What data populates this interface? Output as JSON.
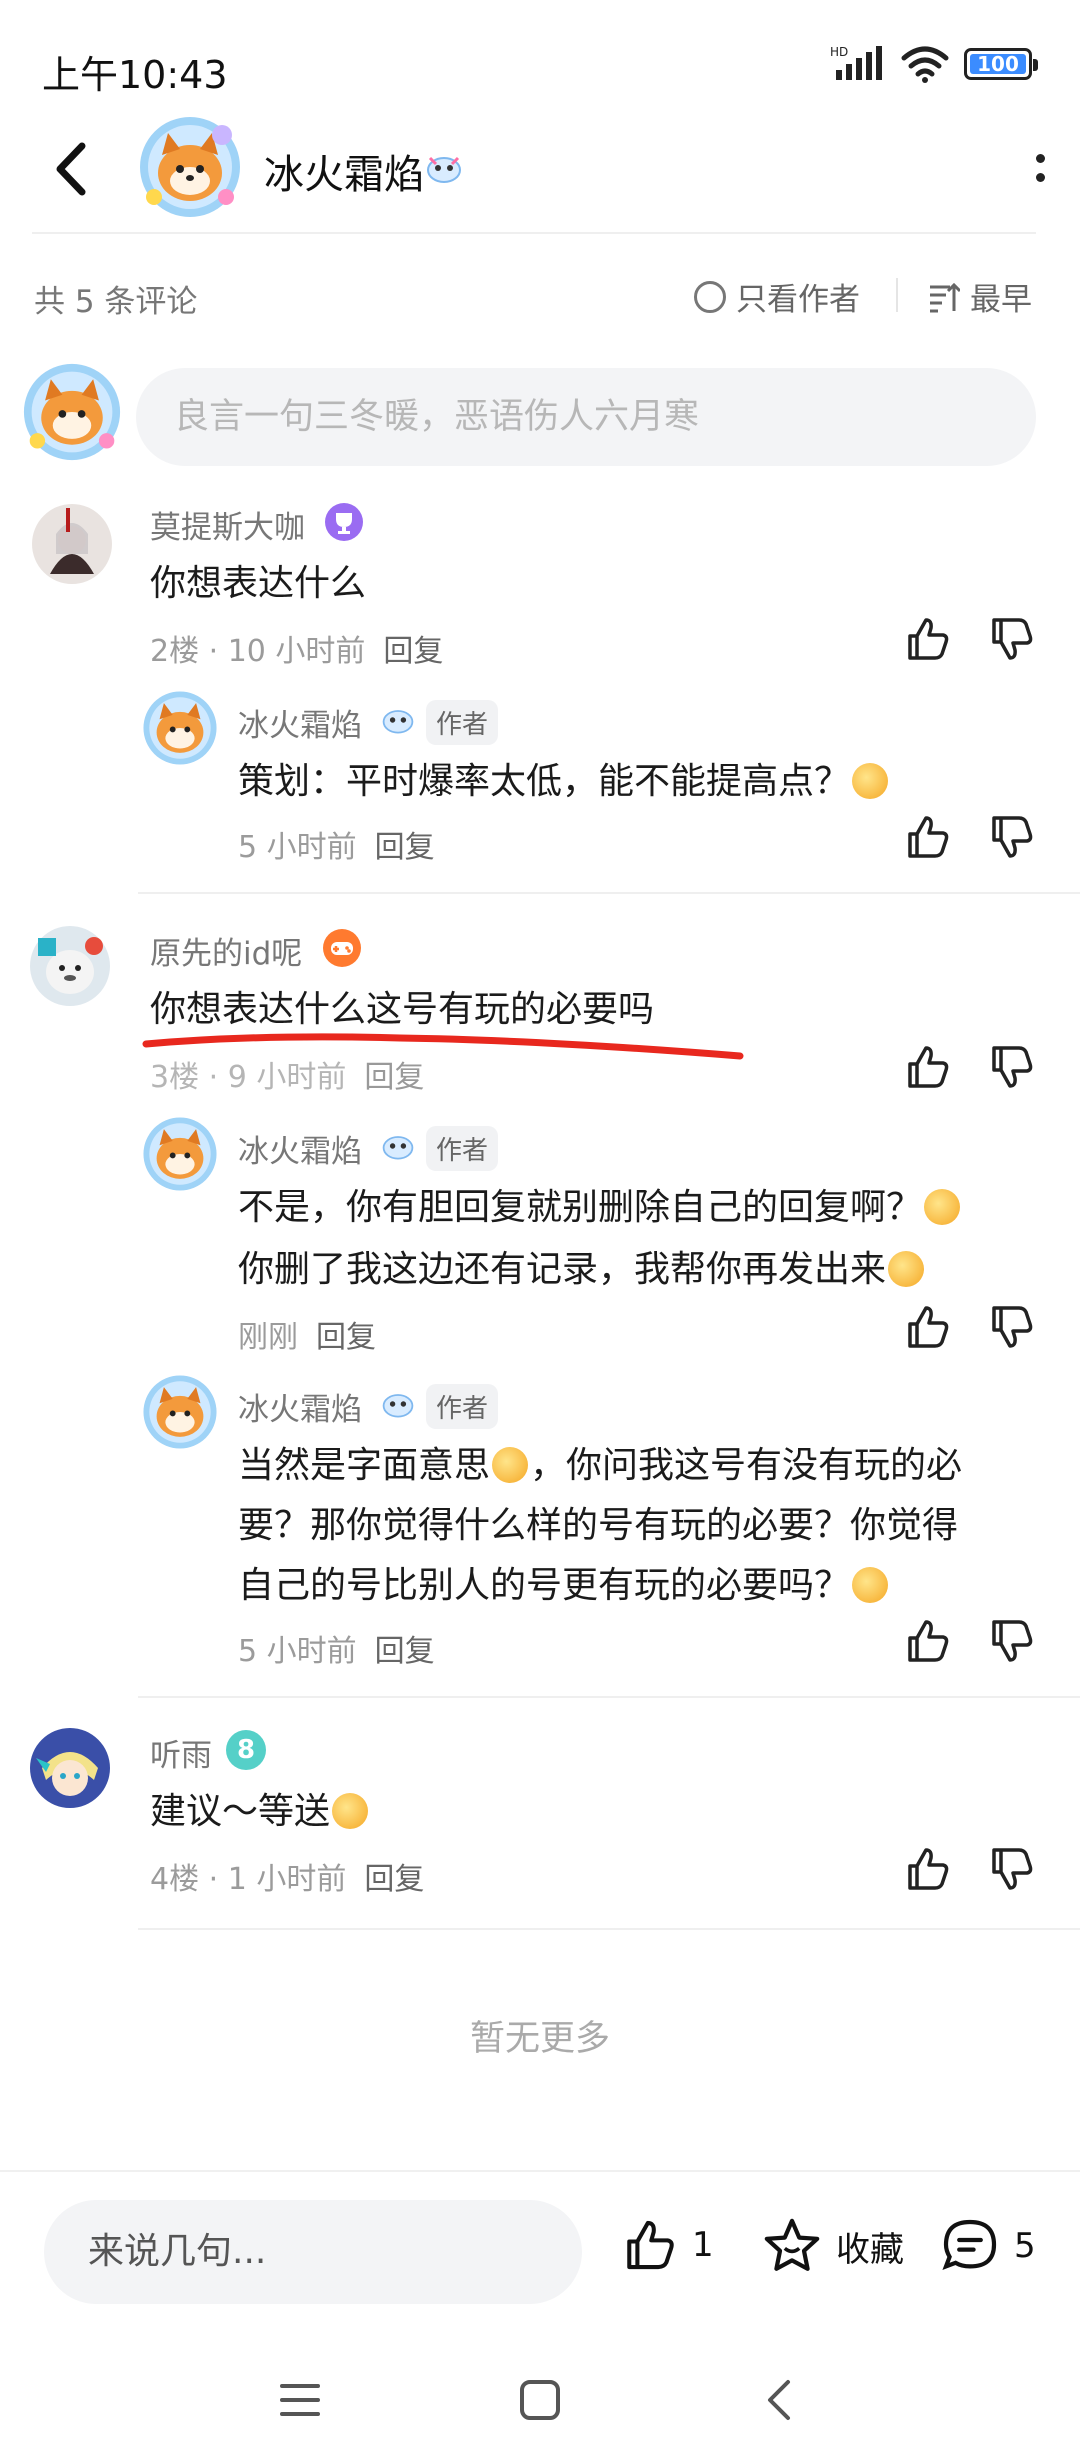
{
  "status_bar": {
    "time": "上午10:43",
    "network": "HD",
    "battery": "100"
  },
  "header": {
    "username": "冰火霜焰"
  },
  "comments_bar": {
    "count_label": "共 5 条评论",
    "author_only": "只看作者",
    "sort": "最早"
  },
  "compose": {
    "placeholder": "良言一句三冬暖，恶语伤人六月寒"
  },
  "comments": [
    {
      "username": "莫提斯大咖",
      "text": "你想表达什么",
      "floor": "2楼 · 10 小时前",
      "reply_label": "回复",
      "replies": [
        {
          "username": "冰火霜焰",
          "tag": "作者",
          "text": "策划：平时爆率太低，能不能提高点？",
          "time": "5 小时前",
          "reply_label": "回复"
        }
      ]
    },
    {
      "username": "原先的id呢",
      "text": "你想表达什么这号有玩的必要吗",
      "floor": "3楼 · 9 小时前",
      "reply_label": "回复",
      "replies": [
        {
          "username": "冰火霜焰",
          "tag": "作者",
          "line1": "不是，你有胆回复就别删除自己的回复啊？",
          "line2": "你删了我这边还有记录，我帮你再发出来",
          "time": "刚刚",
          "reply_label": "回复"
        },
        {
          "username": "冰火霜焰",
          "tag": "作者",
          "line1a": "当然是字面意思",
          "line1b": "，你问我这号有没有玩的必",
          "line2": "要？那你觉得什么样的号有玩的必要？你觉得",
          "line3": "自己的号比别人的号更有玩的必要吗？",
          "time": "5 小时前",
          "reply_label": "回复"
        }
      ]
    },
    {
      "username": "听雨",
      "level": "8",
      "text": "建议～等送",
      "floor": "4楼 · 1 小时前",
      "reply_label": "回复"
    }
  ],
  "no_more": "暂无更多",
  "bottom": {
    "input_placeholder": "来说几句...",
    "like_count": "1",
    "favorite_label": "收藏",
    "comment_count": "5"
  }
}
